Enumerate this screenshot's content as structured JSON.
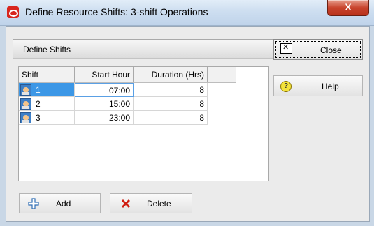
{
  "window": {
    "title": "Define Resource Shifts: 3-shift Operations",
    "close_symbol": "X"
  },
  "group": {
    "title": "Define Shifts"
  },
  "table": {
    "columns": [
      "Shift",
      "Start Hour",
      "Duration (Hrs)"
    ],
    "rows": [
      {
        "shift": "1",
        "start": "07:00",
        "duration": "8"
      },
      {
        "shift": "2",
        "start": "15:00",
        "duration": "8"
      },
      {
        "shift": "3",
        "start": "23:00",
        "duration": "8"
      }
    ]
  },
  "buttons": {
    "add": "Add",
    "delete": "Delete",
    "close": "Close",
    "help": "Help"
  },
  "icons": {
    "add": "plus-outline-icon",
    "delete": "red-x-icon",
    "help": "question-mark-icon",
    "close": "close-window-icon",
    "shift": "people-icon"
  },
  "colors": {
    "selection": "#3c97e6",
    "delete_icon": "#d01e12",
    "add_icon": "#2f6db5"
  }
}
